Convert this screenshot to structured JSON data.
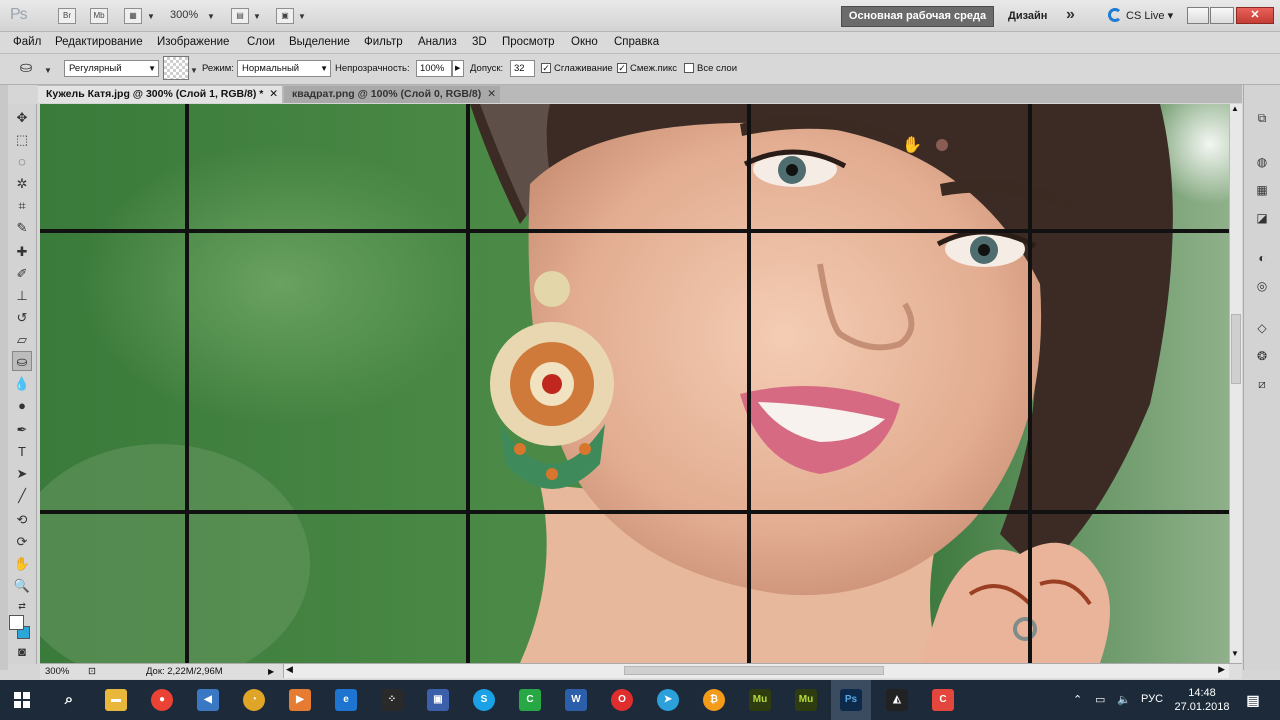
{
  "appbar": {
    "logo": "Ps",
    "br": "Br",
    "mb": "Mb",
    "zoom": "300%",
    "workspace": "Основная рабочая среда",
    "design": "Дизайн",
    "cslive": "CS Live",
    "close_glyph": "✕"
  },
  "menu": [
    "Файл",
    "Редактирование",
    "Изображение",
    "Слои",
    "Выделение",
    "Фильтр",
    "Анализ",
    "3D",
    "Просмотр",
    "Окно",
    "Справка"
  ],
  "options": {
    "fill_source": "Регулярный",
    "mode_label": "Режим:",
    "mode_value": "Нормальный",
    "opacity_label": "Непрозрачность:",
    "opacity_value": "100%",
    "tolerance_label": "Допуск:",
    "tolerance_value": "32",
    "antialias_label": "Сглаживание",
    "contiguous_label": "Смеж.пикс",
    "all_layers_label": "Все слои",
    "antialias_checked": true,
    "contiguous_checked": true,
    "all_layers_checked": false
  },
  "tabs": [
    {
      "label": "Кужель Катя.jpg @ 300% (Слой 1, RGB/8) *",
      "active": true
    },
    {
      "label": "квадрат.png @ 100% (Слой 0, RGB/8)",
      "active": false
    }
  ],
  "status": {
    "zoom": "300%",
    "doc": "Док: 2,22M/2,96M"
  },
  "taskbar": {
    "lang": "РУС",
    "time": "14:48",
    "date": "27.01.2018"
  },
  "colors": {
    "accent": "#1d7bd1",
    "taskbar": "#1c2a3a",
    "grid": "#111111"
  }
}
